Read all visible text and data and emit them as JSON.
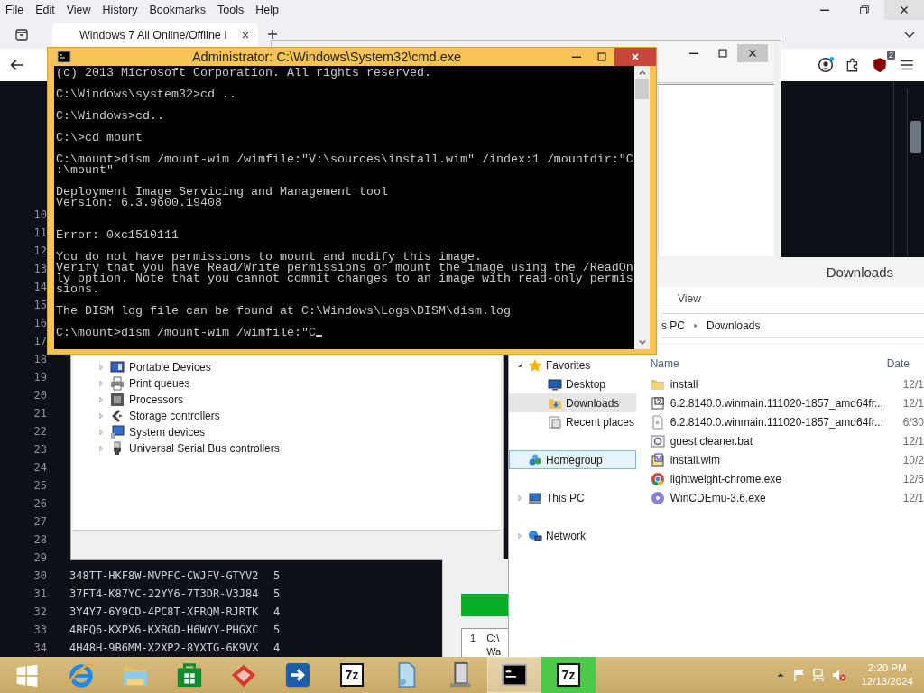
{
  "browser": {
    "menu": [
      "File",
      "Edit",
      "View",
      "History",
      "Bookmarks",
      "Tools",
      "Help"
    ],
    "tab": {
      "title": "Windows 7 All Online/Offline I",
      "selected": true
    },
    "extension_badge": "2",
    "editor": {
      "lines": [
        {
          "number": "10"
        },
        {
          "number": "11"
        },
        {
          "number": "12"
        },
        {
          "number": "13"
        },
        {
          "number": "14"
        },
        {
          "number": "15"
        },
        {
          "number": "16"
        },
        {
          "number": "17"
        },
        {
          "number": "18"
        },
        {
          "number": "19"
        },
        {
          "number": "20"
        },
        {
          "number": "21"
        },
        {
          "number": "22"
        },
        {
          "number": "23"
        },
        {
          "number": "24"
        },
        {
          "number": "25"
        },
        {
          "number": "26"
        },
        {
          "number": "27"
        },
        {
          "number": "28"
        },
        {
          "number": "29"
        },
        {
          "number": "30",
          "key": "348TT-HKF8W-MVPFC-CWJFV-GTYV2",
          "count": "5"
        },
        {
          "number": "31",
          "key": "37FT4-K87YC-22YY6-7T3DR-V3J84",
          "count": "5"
        },
        {
          "number": "32",
          "key": "3Y4Y7-6Y9CD-4PC8T-XFRQM-RJRTK",
          "count": "4"
        },
        {
          "number": "33",
          "key": "4BPQ6-KXPX6-KXBGD-H6WYY-PHGXC",
          "count": "5"
        },
        {
          "number": "34",
          "key": "4H48H-9B6MM-X2XP2-8YXTG-6K9VX",
          "count": "4"
        }
      ]
    }
  },
  "device_manager": {
    "items": [
      {
        "label": "Portable Devices",
        "kind": "portable"
      },
      {
        "label": "Print queues",
        "kind": "printer"
      },
      {
        "label": "Processors",
        "kind": "processor"
      },
      {
        "label": "Storage controllers",
        "kind": "storage"
      },
      {
        "label": "System devices",
        "kind": "system"
      },
      {
        "label": "Universal Serial Bus controllers",
        "kind": "usb"
      }
    ]
  },
  "small_window": {
    "list": {
      "index": "1",
      "line_1": "C:\\",
      "line_2": "Wa"
    }
  },
  "explorer": {
    "title": "Downloads",
    "ribbon_tabs": [
      "View"
    ],
    "breadcrumb": [
      "s PC",
      "Downloads"
    ],
    "nav": [
      {
        "label": "Favorites",
        "kind": "star",
        "has_children": true,
        "expanded": true,
        "selected": false,
        "hover": false,
        "children": [
          {
            "label": "Desktop",
            "kind": "desktop",
            "selected": false,
            "hover": false
          },
          {
            "label": "Downloads",
            "kind": "downloads",
            "selected": true,
            "hover": false
          },
          {
            "label": "Recent places",
            "kind": "recent",
            "selected": false,
            "hover": false
          }
        ]
      },
      {
        "label": "Homegroup",
        "kind": "homegroup",
        "has_children": false,
        "expanded": false,
        "selected": false,
        "hover": true
      },
      {
        "label": "This PC",
        "kind": "pc",
        "has_children": true,
        "expanded": false,
        "selected": false,
        "hover": false
      },
      {
        "label": "Network",
        "kind": "network",
        "has_children": true,
        "expanded": false,
        "selected": false,
        "hover": false
      }
    ],
    "columns": [
      "Name",
      "Date"
    ],
    "files": [
      {
        "name": "install",
        "kind": "folder",
        "date": "12/1"
      },
      {
        "name": "6.2.8140.0.winmain.111020-1857_amd64fr...",
        "kind": "archive",
        "date": "12/1"
      },
      {
        "name": "6.2.8140.0.winmain.111020-1857_amd64fr...",
        "kind": "file",
        "date": "6/30"
      },
      {
        "name": "guest cleaner.bat",
        "kind": "batch",
        "date": "12/1"
      },
      {
        "name": "install.wim",
        "kind": "wim",
        "date": "10/2"
      },
      {
        "name": "lightweight-chrome.exe",
        "kind": "chrome",
        "date": "12/6"
      },
      {
        "name": "WinCDEmu-3.6.exe",
        "kind": "disc",
        "date": "12/1"
      }
    ]
  },
  "cmd": {
    "title": "Administrator: C:\\Windows\\System32\\cmd.exe",
    "cursor": true,
    "blocks": [
      {
        "kind": "normal",
        "lines": [
          "(c) 2013 Microsoft Corporation. All rights reserved."
        ]
      },
      {
        "kind": "normal",
        "lines": [
          "C:\\Windows\\system32>cd .."
        ]
      },
      {
        "kind": "normal",
        "lines": [
          "C:\\Windows>cd.."
        ]
      },
      {
        "kind": "normal",
        "lines": [
          "C:\\>cd mount"
        ]
      },
      {
        "kind": "normal",
        "lines": [
          "C:\\mount>dism /mount-wim /wimfile:\"V:\\sources\\install.wim\" /index:1 /mountdir:\"C",
          ":\\mount\""
        ]
      },
      {
        "kind": "wide",
        "lines": [
          "Deployment Image Servicing and Management tool",
          "Version: 6.3.9600.19408"
        ]
      },
      {
        "kind": "normal",
        "lines": [
          "Error: 0xc1510111"
        ]
      },
      {
        "kind": "normal",
        "lines": [
          "You do not have permissions to mount and modify this image.",
          "Verify that you have Read/Write permissions or mount the image using the /ReadOn",
          "ly option. Note that you cannot commit changes to an image with read-only permis",
          "sions."
        ]
      },
      {
        "kind": "normal",
        "lines": [
          "The DISM log file can be found at C:\\Windows\\Logs\\DISM\\dism.log"
        ]
      },
      {
        "kind": "normal",
        "lines": [
          "C:\\mount>dism /mount-wim /wimfile:\"C"
        ]
      }
    ]
  },
  "taskbar": {
    "apps": [
      {
        "kind": "start",
        "focused": false,
        "flashing": false
      },
      {
        "kind": "ie",
        "focused": false,
        "flashing": false
      },
      {
        "kind": "explorer",
        "focused": false,
        "flashing": false
      },
      {
        "kind": "store",
        "focused": false,
        "flashing": false
      },
      {
        "kind": "red",
        "focused": false,
        "flashing": false
      },
      {
        "kind": "blue",
        "focused": false,
        "flashing": false
      },
      {
        "kind": "sevenzip",
        "label": "7z",
        "focused": false,
        "flashing": false
      },
      {
        "kind": "drive",
        "focused": false,
        "flashing": false
      },
      {
        "kind": "server",
        "focused": false,
        "flashing": false
      },
      {
        "kind": "cmd",
        "focused": true,
        "flashing": false
      },
      {
        "kind": "sevenzip",
        "label": "7z",
        "focused": false,
        "flashing": true
      }
    ],
    "clock": {
      "time": "2:20 PM",
      "date": "12/13/2024"
    }
  }
}
